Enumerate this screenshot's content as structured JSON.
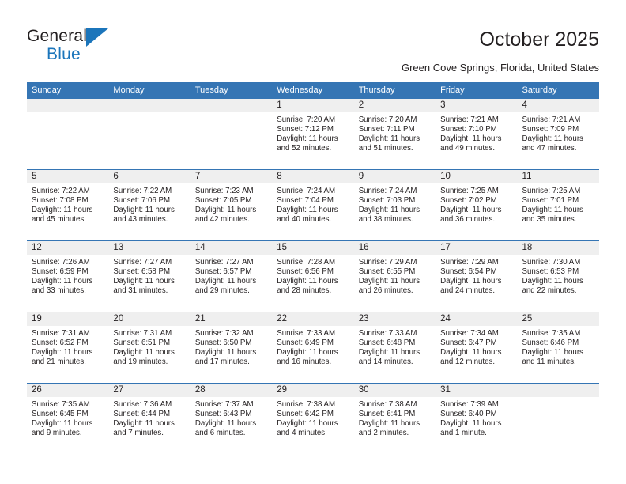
{
  "brand": {
    "name_top": "General",
    "name_bottom": "Blue",
    "accent_color": "#1b75bb"
  },
  "header": {
    "title": "October 2025",
    "subtitle": "Green Cove Springs, Florida, United States"
  },
  "calendar": {
    "header_color": "#3575b4",
    "date_band_color": "#efefef",
    "weekdays": [
      "Sunday",
      "Monday",
      "Tuesday",
      "Wednesday",
      "Thursday",
      "Friday",
      "Saturday"
    ],
    "weeks": [
      [
        {
          "date": "",
          "empty": true
        },
        {
          "date": "",
          "empty": true
        },
        {
          "date": "",
          "empty": true
        },
        {
          "date": "1",
          "sunrise": "Sunrise: 7:20 AM",
          "sunset": "Sunset: 7:12 PM",
          "daylight": "Daylight: 11 hours and 52 minutes."
        },
        {
          "date": "2",
          "sunrise": "Sunrise: 7:20 AM",
          "sunset": "Sunset: 7:11 PM",
          "daylight": "Daylight: 11 hours and 51 minutes."
        },
        {
          "date": "3",
          "sunrise": "Sunrise: 7:21 AM",
          "sunset": "Sunset: 7:10 PM",
          "daylight": "Daylight: 11 hours and 49 minutes."
        },
        {
          "date": "4",
          "sunrise": "Sunrise: 7:21 AM",
          "sunset": "Sunset: 7:09 PM",
          "daylight": "Daylight: 11 hours and 47 minutes."
        }
      ],
      [
        {
          "date": "5",
          "sunrise": "Sunrise: 7:22 AM",
          "sunset": "Sunset: 7:08 PM",
          "daylight": "Daylight: 11 hours and 45 minutes."
        },
        {
          "date": "6",
          "sunrise": "Sunrise: 7:22 AM",
          "sunset": "Sunset: 7:06 PM",
          "daylight": "Daylight: 11 hours and 43 minutes."
        },
        {
          "date": "7",
          "sunrise": "Sunrise: 7:23 AM",
          "sunset": "Sunset: 7:05 PM",
          "daylight": "Daylight: 11 hours and 42 minutes."
        },
        {
          "date": "8",
          "sunrise": "Sunrise: 7:24 AM",
          "sunset": "Sunset: 7:04 PM",
          "daylight": "Daylight: 11 hours and 40 minutes."
        },
        {
          "date": "9",
          "sunrise": "Sunrise: 7:24 AM",
          "sunset": "Sunset: 7:03 PM",
          "daylight": "Daylight: 11 hours and 38 minutes."
        },
        {
          "date": "10",
          "sunrise": "Sunrise: 7:25 AM",
          "sunset": "Sunset: 7:02 PM",
          "daylight": "Daylight: 11 hours and 36 minutes."
        },
        {
          "date": "11",
          "sunrise": "Sunrise: 7:25 AM",
          "sunset": "Sunset: 7:01 PM",
          "daylight": "Daylight: 11 hours and 35 minutes."
        }
      ],
      [
        {
          "date": "12",
          "sunrise": "Sunrise: 7:26 AM",
          "sunset": "Sunset: 6:59 PM",
          "daylight": "Daylight: 11 hours and 33 minutes."
        },
        {
          "date": "13",
          "sunrise": "Sunrise: 7:27 AM",
          "sunset": "Sunset: 6:58 PM",
          "daylight": "Daylight: 11 hours and 31 minutes."
        },
        {
          "date": "14",
          "sunrise": "Sunrise: 7:27 AM",
          "sunset": "Sunset: 6:57 PM",
          "daylight": "Daylight: 11 hours and 29 minutes."
        },
        {
          "date": "15",
          "sunrise": "Sunrise: 7:28 AM",
          "sunset": "Sunset: 6:56 PM",
          "daylight": "Daylight: 11 hours and 28 minutes."
        },
        {
          "date": "16",
          "sunrise": "Sunrise: 7:29 AM",
          "sunset": "Sunset: 6:55 PM",
          "daylight": "Daylight: 11 hours and 26 minutes."
        },
        {
          "date": "17",
          "sunrise": "Sunrise: 7:29 AM",
          "sunset": "Sunset: 6:54 PM",
          "daylight": "Daylight: 11 hours and 24 minutes."
        },
        {
          "date": "18",
          "sunrise": "Sunrise: 7:30 AM",
          "sunset": "Sunset: 6:53 PM",
          "daylight": "Daylight: 11 hours and 22 minutes."
        }
      ],
      [
        {
          "date": "19",
          "sunrise": "Sunrise: 7:31 AM",
          "sunset": "Sunset: 6:52 PM",
          "daylight": "Daylight: 11 hours and 21 minutes."
        },
        {
          "date": "20",
          "sunrise": "Sunrise: 7:31 AM",
          "sunset": "Sunset: 6:51 PM",
          "daylight": "Daylight: 11 hours and 19 minutes."
        },
        {
          "date": "21",
          "sunrise": "Sunrise: 7:32 AM",
          "sunset": "Sunset: 6:50 PM",
          "daylight": "Daylight: 11 hours and 17 minutes."
        },
        {
          "date": "22",
          "sunrise": "Sunrise: 7:33 AM",
          "sunset": "Sunset: 6:49 PM",
          "daylight": "Daylight: 11 hours and 16 minutes."
        },
        {
          "date": "23",
          "sunrise": "Sunrise: 7:33 AM",
          "sunset": "Sunset: 6:48 PM",
          "daylight": "Daylight: 11 hours and 14 minutes."
        },
        {
          "date": "24",
          "sunrise": "Sunrise: 7:34 AM",
          "sunset": "Sunset: 6:47 PM",
          "daylight": "Daylight: 11 hours and 12 minutes."
        },
        {
          "date": "25",
          "sunrise": "Sunrise: 7:35 AM",
          "sunset": "Sunset: 6:46 PM",
          "daylight": "Daylight: 11 hours and 11 minutes."
        }
      ],
      [
        {
          "date": "26",
          "sunrise": "Sunrise: 7:35 AM",
          "sunset": "Sunset: 6:45 PM",
          "daylight": "Daylight: 11 hours and 9 minutes."
        },
        {
          "date": "27",
          "sunrise": "Sunrise: 7:36 AM",
          "sunset": "Sunset: 6:44 PM",
          "daylight": "Daylight: 11 hours and 7 minutes."
        },
        {
          "date": "28",
          "sunrise": "Sunrise: 7:37 AM",
          "sunset": "Sunset: 6:43 PM",
          "daylight": "Daylight: 11 hours and 6 minutes."
        },
        {
          "date": "29",
          "sunrise": "Sunrise: 7:38 AM",
          "sunset": "Sunset: 6:42 PM",
          "daylight": "Daylight: 11 hours and 4 minutes."
        },
        {
          "date": "30",
          "sunrise": "Sunrise: 7:38 AM",
          "sunset": "Sunset: 6:41 PM",
          "daylight": "Daylight: 11 hours and 2 minutes."
        },
        {
          "date": "31",
          "sunrise": "Sunrise: 7:39 AM",
          "sunset": "Sunset: 6:40 PM",
          "daylight": "Daylight: 11 hours and 1 minute."
        },
        {
          "date": "",
          "empty": true
        }
      ]
    ]
  }
}
